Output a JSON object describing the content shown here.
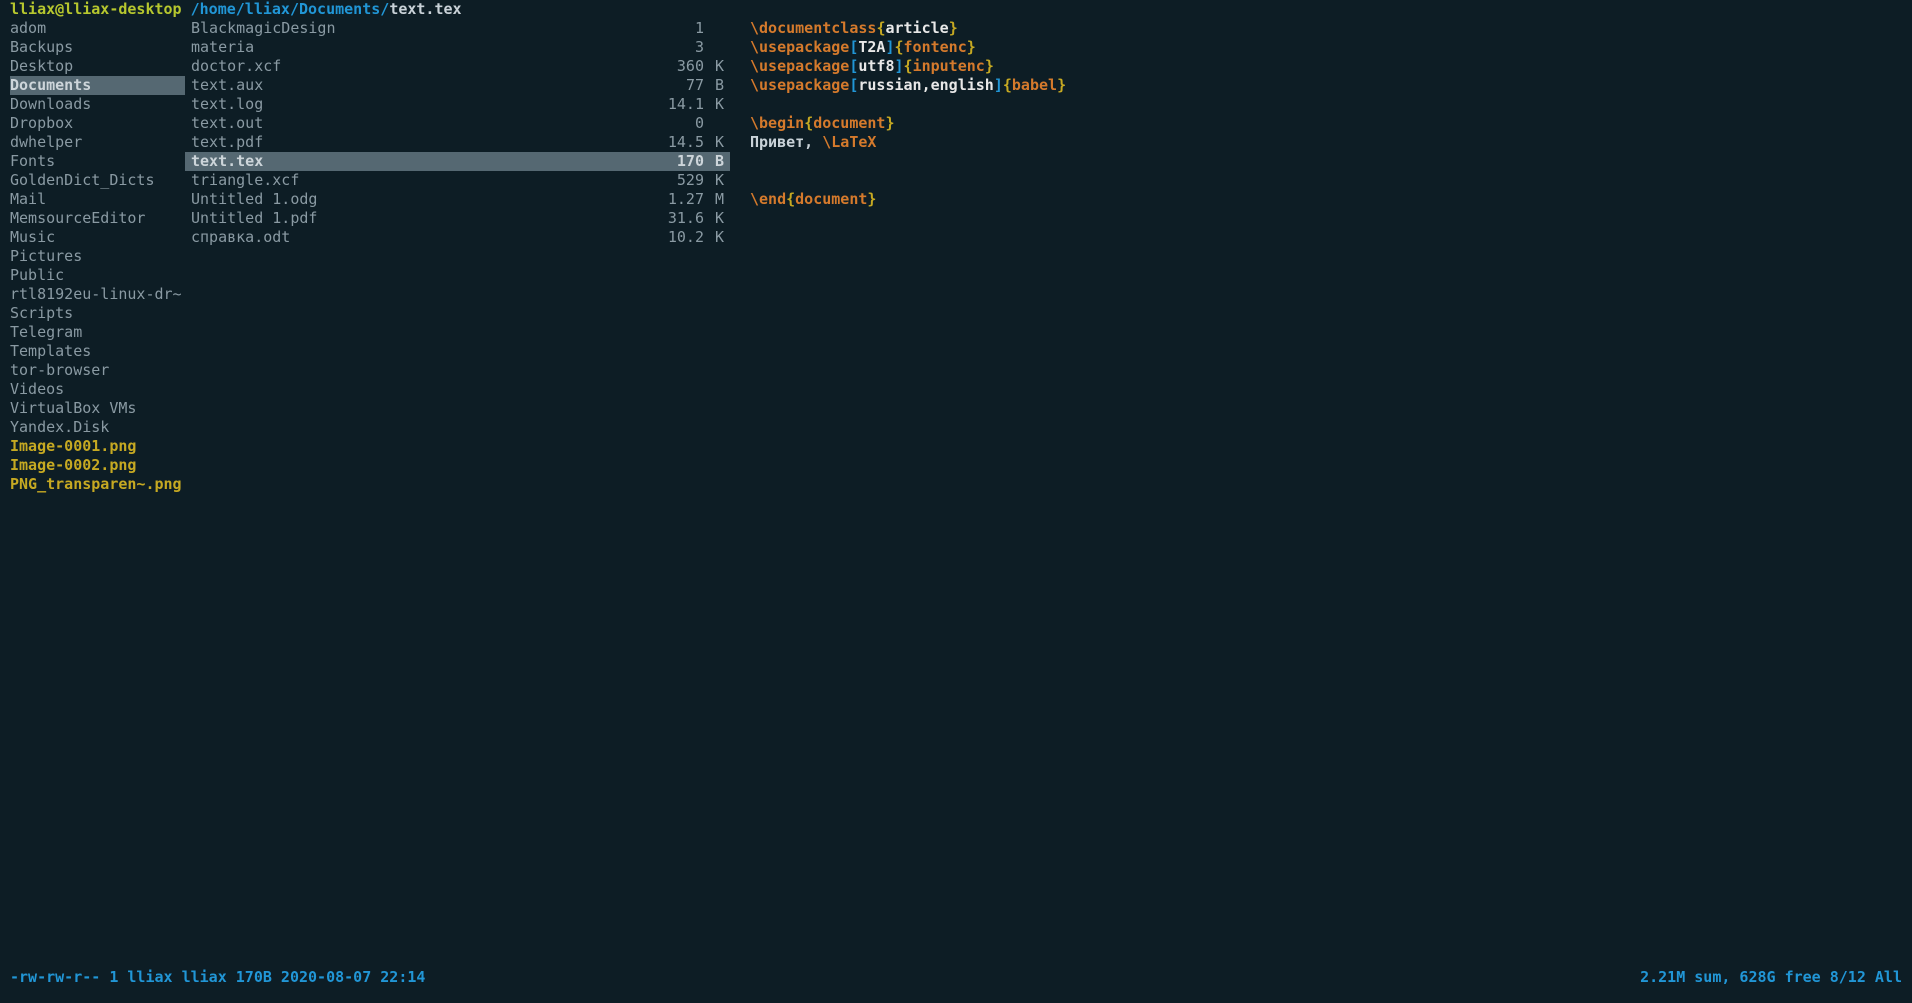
{
  "header": {
    "user_host": "lliax@lliax-desktop",
    "path": " /home/lliax/Documents/",
    "file": "text.tex"
  },
  "left_pane": {
    "selected_index": 3,
    "items": [
      {
        "name": "adom",
        "type": "dir"
      },
      {
        "name": "Backups",
        "type": "dir"
      },
      {
        "name": "Desktop",
        "type": "dir"
      },
      {
        "name": "Documents",
        "type": "dir"
      },
      {
        "name": "Downloads",
        "type": "dir"
      },
      {
        "name": "Dropbox",
        "type": "dir"
      },
      {
        "name": "dwhelper",
        "type": "dir"
      },
      {
        "name": "Fonts",
        "type": "dir"
      },
      {
        "name": "GoldenDict_Dicts",
        "type": "dir"
      },
      {
        "name": "Mail",
        "type": "dir"
      },
      {
        "name": "MemsourceEditor",
        "type": "dir"
      },
      {
        "name": "Music",
        "type": "dir"
      },
      {
        "name": "Pictures",
        "type": "dir"
      },
      {
        "name": "Public",
        "type": "dir"
      },
      {
        "name": "rtl8192eu-linux-dr~",
        "type": "dir"
      },
      {
        "name": "Scripts",
        "type": "dir"
      },
      {
        "name": "Telegram",
        "type": "dir"
      },
      {
        "name": "Templates",
        "type": "dir"
      },
      {
        "name": "tor-browser",
        "type": "dir"
      },
      {
        "name": "Videos",
        "type": "dir"
      },
      {
        "name": "VirtualBox VMs",
        "type": "dir"
      },
      {
        "name": "Yandex.Disk",
        "type": "dir"
      },
      {
        "name": "Image-0001.png",
        "type": "img"
      },
      {
        "name": "Image-0002.png",
        "type": "img"
      },
      {
        "name": "PNG_transparen~.png",
        "type": "img"
      }
    ]
  },
  "mid_pane": {
    "selected_index": 7,
    "items": [
      {
        "name": "BlackmagicDesign",
        "size": "1",
        "unit": ""
      },
      {
        "name": "materia",
        "size": "3",
        "unit": ""
      },
      {
        "name": "doctor.xcf",
        "size": "360",
        "unit": "K"
      },
      {
        "name": "text.aux",
        "size": "77",
        "unit": "B"
      },
      {
        "name": "text.log",
        "size": "14.1",
        "unit": "K"
      },
      {
        "name": "text.out",
        "size": "0",
        "unit": ""
      },
      {
        "name": "text.pdf",
        "size": "14.5",
        "unit": "K"
      },
      {
        "name": "text.tex",
        "size": "170",
        "unit": "B"
      },
      {
        "name": "triangle.xcf",
        "size": "529",
        "unit": "K"
      },
      {
        "name": "Untitled 1.odg",
        "size": "1.27",
        "unit": "M"
      },
      {
        "name": "Untitled 1.pdf",
        "size": "31.6",
        "unit": "K"
      },
      {
        "name": "справка.odt",
        "size": "10.2",
        "unit": "K"
      }
    ]
  },
  "editor": {
    "lines": [
      [
        {
          "t": "\\documentclass",
          "c": "k-cmd"
        },
        {
          "t": "{",
          "c": "k-brace"
        },
        {
          "t": "article",
          "c": "k-arg"
        },
        {
          "t": "}",
          "c": "k-brace"
        }
      ],
      [
        {
          "t": "\\usepackage",
          "c": "k-cmd"
        },
        {
          "t": "[",
          "c": "k-bracket"
        },
        {
          "t": "T2A",
          "c": "k-arg"
        },
        {
          "t": "]",
          "c": "k-bracket"
        },
        {
          "t": "{",
          "c": "k-brace"
        },
        {
          "t": "fontenc",
          "c": "k-cmd"
        },
        {
          "t": "}",
          "c": "k-brace"
        }
      ],
      [
        {
          "t": "\\usepackage",
          "c": "k-cmd"
        },
        {
          "t": "[",
          "c": "k-bracket"
        },
        {
          "t": "utf8",
          "c": "k-arg"
        },
        {
          "t": "]",
          "c": "k-bracket"
        },
        {
          "t": "{",
          "c": "k-brace"
        },
        {
          "t": "inputenc",
          "c": "k-cmd"
        },
        {
          "t": "}",
          "c": "k-brace"
        }
      ],
      [
        {
          "t": "\\usepackage",
          "c": "k-cmd"
        },
        {
          "t": "[",
          "c": "k-bracket"
        },
        {
          "t": "russian,english",
          "c": "k-arg"
        },
        {
          "t": "]",
          "c": "k-bracket"
        },
        {
          "t": "{",
          "c": "k-brace"
        },
        {
          "t": "babel",
          "c": "k-cmd"
        },
        {
          "t": "}",
          "c": "k-brace"
        }
      ],
      [],
      [
        {
          "t": "\\begin",
          "c": "k-cmd"
        },
        {
          "t": "{",
          "c": "k-brace"
        },
        {
          "t": "document",
          "c": "k-cmd"
        },
        {
          "t": "}",
          "c": "k-brace"
        }
      ],
      [
        {
          "t": "Привет, ",
          "c": "k-txt"
        },
        {
          "t": "\\LaTeX",
          "c": "k-cmd"
        }
      ],
      [],
      [],
      [
        {
          "t": "\\end",
          "c": "k-cmd"
        },
        {
          "t": "{",
          "c": "k-brace"
        },
        {
          "t": "document",
          "c": "k-cmd"
        },
        {
          "t": "}",
          "c": "k-brace"
        }
      ]
    ]
  },
  "status": {
    "left": "-rw-rw-r-- 1 lliax lliax 170B 2020-08-07 22:14",
    "right": "2.21M sum, 628G free  8/12  All"
  }
}
